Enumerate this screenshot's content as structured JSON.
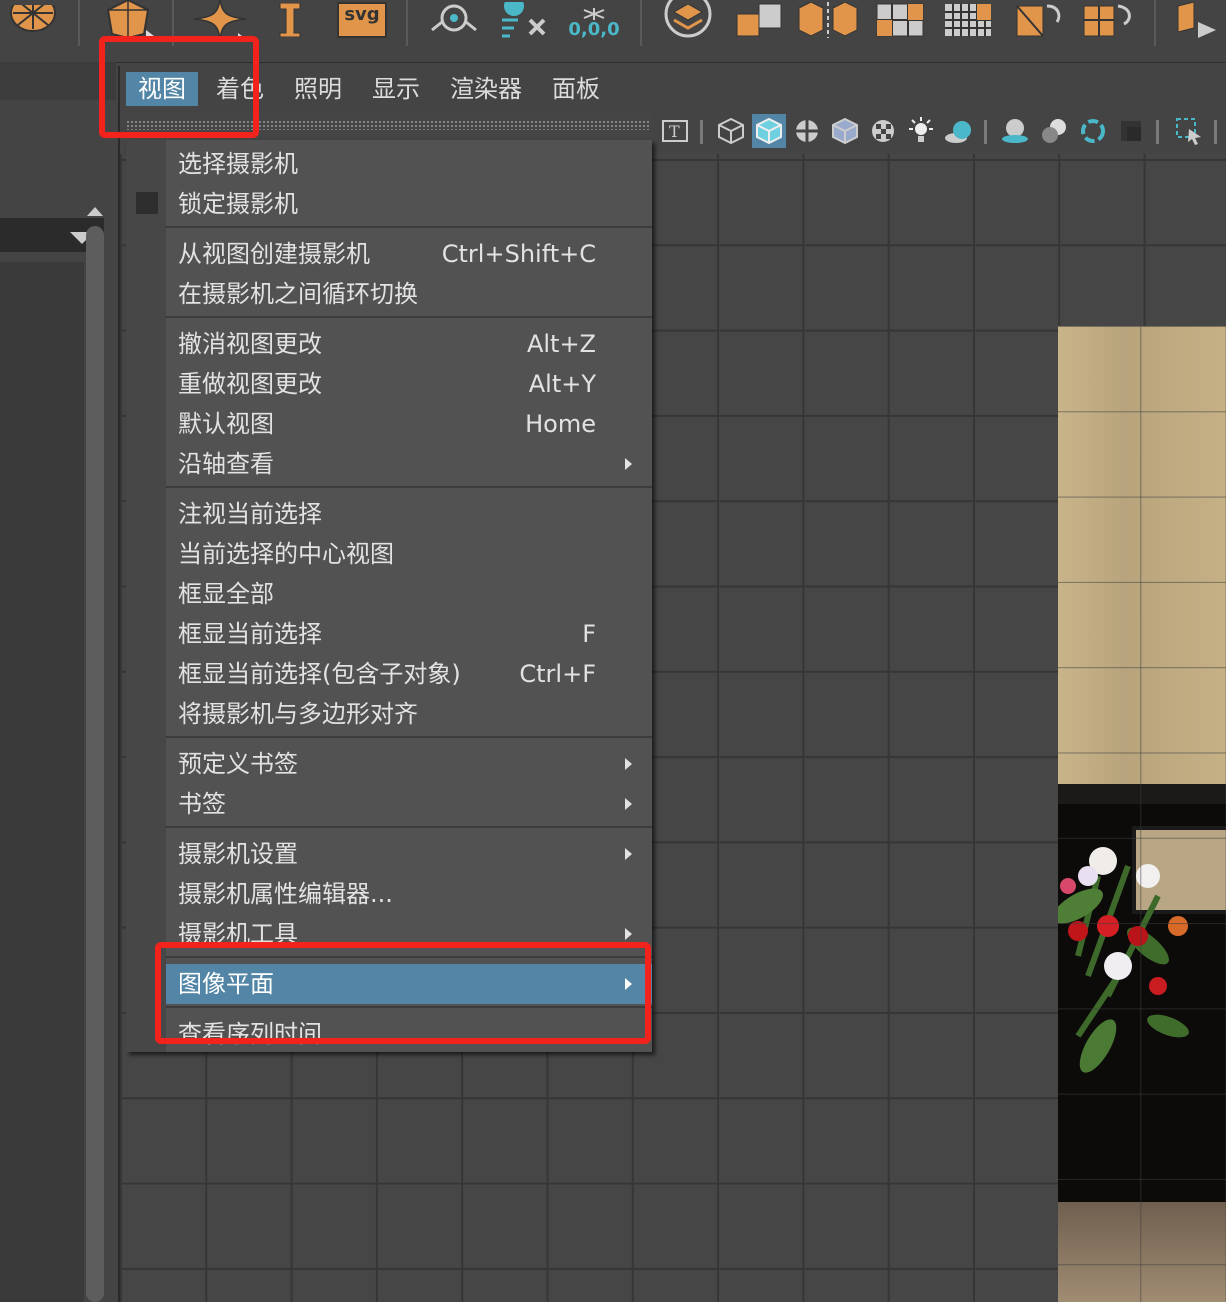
{
  "shelf": {
    "svg_label": "svg",
    "origin_label": "0,0,0"
  },
  "menubar": {
    "items": [
      "视图",
      "着色",
      "照明",
      "显示",
      "渲染器",
      "面板"
    ]
  },
  "view_menu": {
    "items": [
      {
        "label": "选择摄影机",
        "shortcut": "",
        "submenu": false
      },
      {
        "label": "锁定摄影机",
        "shortcut": "",
        "submenu": false,
        "checkbox": true
      },
      {
        "label": "从视图创建摄影机",
        "shortcut": "Ctrl+Shift+C",
        "submenu": false
      },
      {
        "label": "在摄影机之间循环切换",
        "shortcut": "",
        "submenu": false
      },
      {
        "label": "撤消视图更改",
        "shortcut": "Alt+Z",
        "submenu": false
      },
      {
        "label": "重做视图更改",
        "shortcut": "Alt+Y",
        "submenu": false
      },
      {
        "label": "默认视图",
        "shortcut": "Home",
        "submenu": false
      },
      {
        "label": "沿轴查看",
        "shortcut": "",
        "submenu": true
      },
      {
        "label": "注视当前选择",
        "shortcut": "",
        "submenu": false
      },
      {
        "label": "当前选择的中心视图",
        "shortcut": "",
        "submenu": false
      },
      {
        "label": "框显全部",
        "shortcut": "",
        "submenu": false
      },
      {
        "label": "框显当前选择",
        "shortcut": "F",
        "submenu": false
      },
      {
        "label": "框显当前选择(包含子对象)",
        "shortcut": "Ctrl+F",
        "submenu": false
      },
      {
        "label": "将摄影机与多边形对齐",
        "shortcut": "",
        "submenu": false
      },
      {
        "label": "预定义书签",
        "shortcut": "",
        "submenu": true
      },
      {
        "label": "书签",
        "shortcut": "",
        "submenu": true
      },
      {
        "label": "摄影机设置",
        "shortcut": "",
        "submenu": true
      },
      {
        "label": "摄影机属性编辑器...",
        "shortcut": "",
        "submenu": false
      },
      {
        "label": "摄影机工具",
        "shortcut": "",
        "submenu": true
      },
      {
        "label": "图像平面",
        "shortcut": "",
        "submenu": true,
        "highlighted": true
      },
      {
        "label": "查看序列时间",
        "shortcut": "",
        "submenu": false
      }
    ]
  },
  "colors": {
    "highlight": "#5285a6",
    "annotation_red": "#f2231d",
    "menu_bg": "#525252",
    "shelf_icon_orange": "#e0954a",
    "shelf_icon_teal": "#4bb8c9"
  }
}
